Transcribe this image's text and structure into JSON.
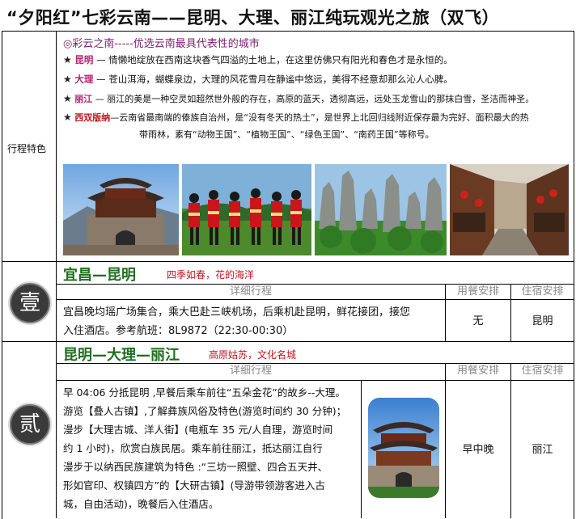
{
  "title": "“夕阳红”七彩云南——昆明、大理、丽江纯玩观光之旅（双飞）",
  "features": {
    "label": "行程特色",
    "heading": "◎彩云之南-----优选云南最具代表性的城市",
    "items": [
      {
        "star": "★",
        "name": "昆明",
        "text": " — 情懒地绽放在西南这块香气四溢的土地上，在这里仿佛只有阳光和春色才是永恒的。"
      },
      {
        "star": "★",
        "name": "大理",
        "text": " — 苍山洱海，蝴蝶泉边，大理的风花雪月在静谧中悠远，美得不经意却那么沁人心脾。"
      },
      {
        "star": "★",
        "name": "丽江",
        "text": " — 丽江的美是一种空灵如超然世外般的存在，高原的蓝天，透彻高远，远处玉龙雪山的那抹白雪，圣洁而神圣。"
      },
      {
        "star": "★",
        "name": "西双版纳",
        "text": "—云南省最南端的傣族自治州，是“没有冬天的热土”，是世界上北回归线附近保存最为完好、面积最大的热",
        "cont": "带雨林，素有“动物王国”、“植物王国”、“绿色王国”、“南药王国”等称号。"
      }
    ],
    "photos": [
      "dali-gate-photo",
      "dancers-photo",
      "stone-forest-photo",
      "old-town-photo"
    ]
  },
  "day1": {
    "emblem": "壹",
    "route": "宜昌—昆明",
    "tagline": "四季如春，花的海洋",
    "col_detail": "详细行程",
    "col_meal": "用餐安排",
    "col_hotel": "住宿安排",
    "detail_line1": "宜昌晚均瑶广场集合，乘大巴赴三峡机场，后乘机赴昆明，鲜花接团，接您",
    "detail_line2": "入住酒店。参考航班：8L9872（22:30-00:30）",
    "meal": "无",
    "hotel": "昆明"
  },
  "day2": {
    "emblem": "贰",
    "route": "昆明—大理—丽江",
    "tagline": "高原姑苏，文化名城",
    "col_detail": "详细行程",
    "col_meal": "用餐安排",
    "col_hotel": "住宿安排",
    "lines": [
      "早 04:06 分抵昆明 ,早餐后乘车前往“五朵金花”的故乡--大理。",
      "游览【叠人古镇】,了解彝族风俗及特色(游览时间约 30 分钟)；",
      "漫步【大理古城、洋人街】(电瓶车 35 元/人自理，游览时间",
      "约 1 小时)，欣赏白族民居。乘车前往丽江，抵达丽江自行",
      "漫步于以纳西民族建筑为特色 :“三坊一照壁、四合五天井、",
      "形如官印、权镇四方”的【大研古镇】(导游带领游客进入古",
      "城，自由活动)，晚餐后入住酒店。"
    ],
    "meal": "早中晚",
    "hotel": "丽江"
  }
}
